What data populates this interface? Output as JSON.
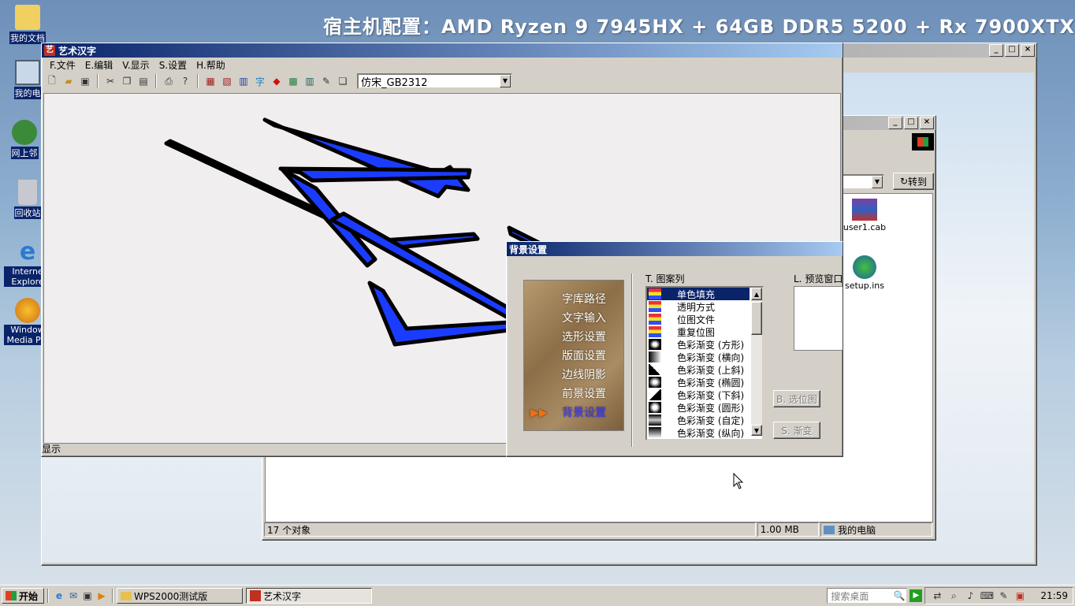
{
  "desktop": {
    "banner": "宿主机配置：AMD Ryzen 9 7945HX + 64GB DDR5 5200 + Rx 7900XTX",
    "icons": [
      "我的文档",
      "我的电",
      "网上邻",
      "回收站",
      "Interne Explore",
      "Window Media Pla"
    ]
  },
  "explorer": {
    "go_label": "转到",
    "files": [
      "user1.cab",
      "setup.ins"
    ],
    "status": {
      "objects": "17 个对象",
      "size": "1.00 MB",
      "location": "我的电脑"
    }
  },
  "app": {
    "title": "艺术汉字",
    "menu": [
      "F.文件",
      "E.编辑",
      "V.显示",
      "S.设置",
      "H.帮助"
    ],
    "font_select": "仿宋_GB2312",
    "status": "显示"
  },
  "dialog": {
    "title": "背景设置",
    "nav": [
      "字库路径",
      "文字输入",
      "选形设置",
      "版面设置",
      "边线阴影",
      "前景设置",
      "背景设置"
    ],
    "pattern_label": "T. 图案列",
    "preview_label": "L. 预览窗口",
    "patterns": [
      "单色填充",
      "透明方式",
      "位图文件",
      "重复位图",
      "色彩渐变 (方形)",
      "色彩渐变 (横向)",
      "色彩渐变 (上斜)",
      "色彩渐变 (椭圆)",
      "色彩渐变 (下斜)",
      "色彩渐变 (圆形)",
      "色彩渐变 (自定)",
      "色彩渐变 (纵向)"
    ],
    "select_image_btn": "B. 选位图",
    "gradient_btn": "S. 渐变"
  },
  "taskbar": {
    "start": "开始",
    "tasks": [
      "WPS2000测试版",
      "艺术汉字"
    ],
    "search_placeholder": "搜索桌面",
    "clock": "21:59"
  },
  "colors": {
    "titlebar": "#0a246a",
    "glyph_fill": "#1a3cff",
    "window_bg": "#d4d0c8"
  }
}
